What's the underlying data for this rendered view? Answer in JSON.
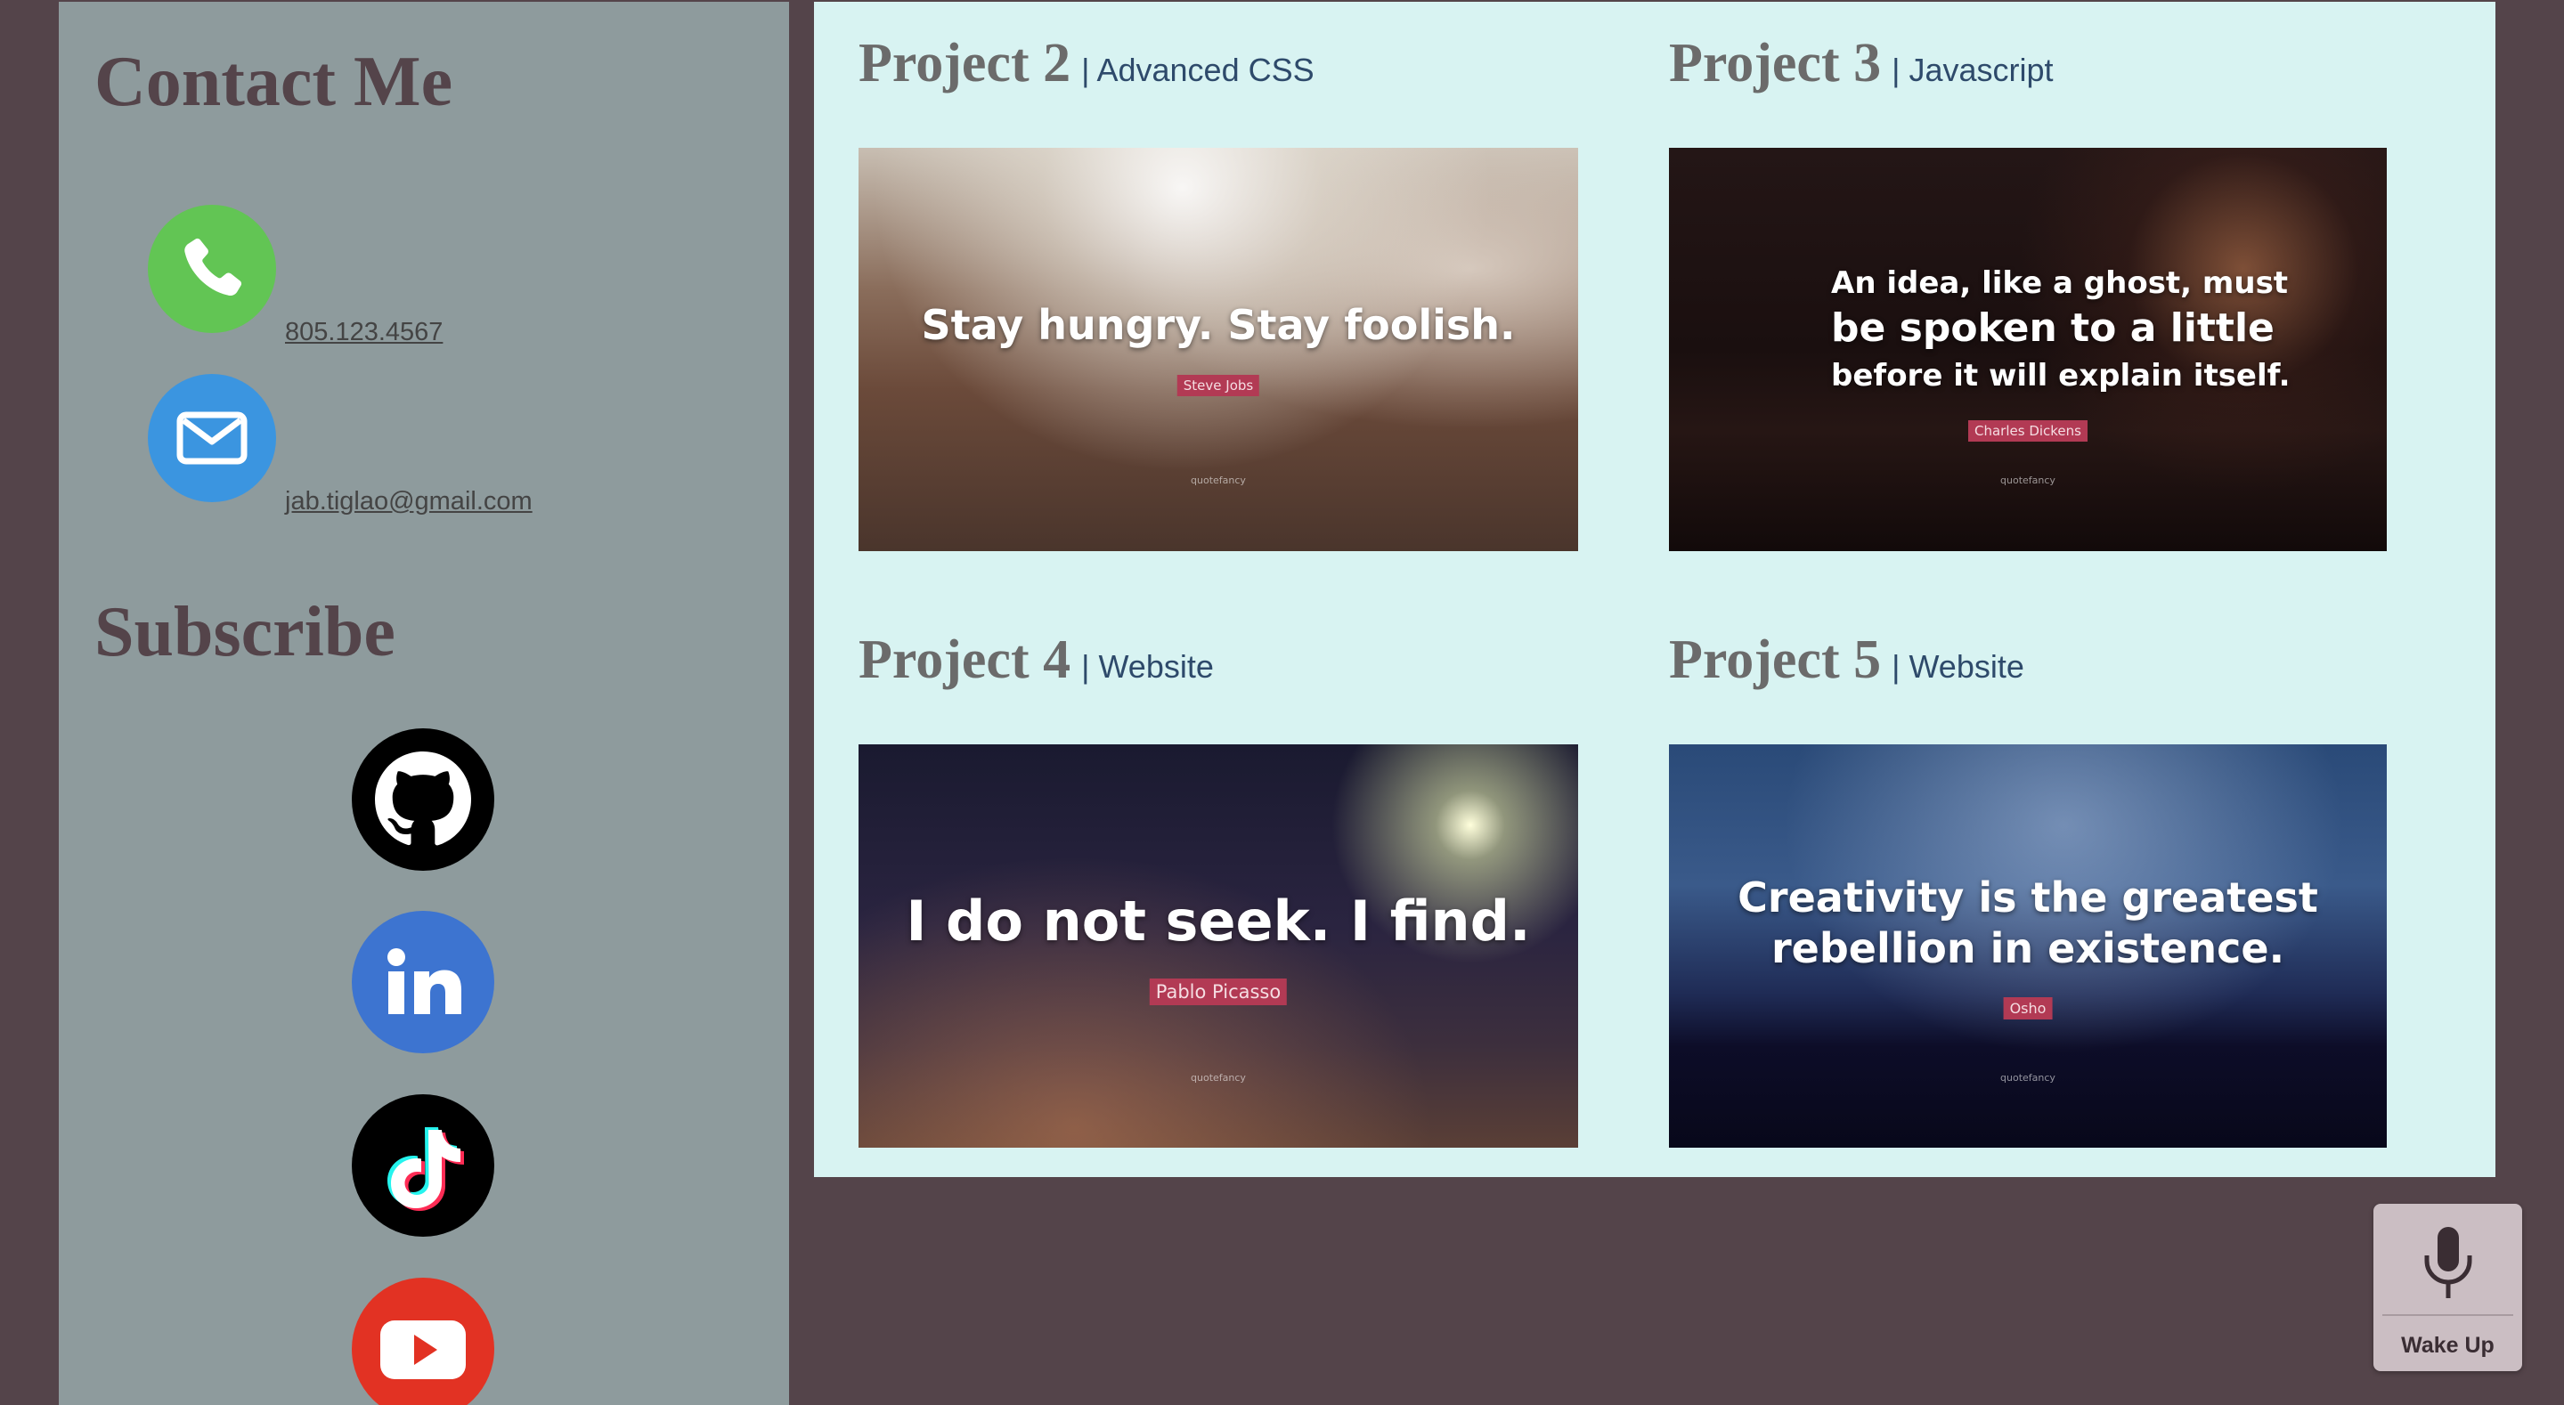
{
  "colors": {
    "page_bg": "#54444a",
    "sidebar_bg": "#8e9b9d",
    "main_bg": "#d8f3f2",
    "phone_green": "#62c554",
    "mail_blue": "#3b95e0",
    "linkedin_blue": "#3d74d0",
    "youtube_red": "#e23223"
  },
  "sidebar": {
    "contact_title": "Contact Me",
    "phone": {
      "icon": "phone-icon",
      "text": "805.123.4567"
    },
    "email": {
      "icon": "mail-icon",
      "text": "jab.tiglao@gmail.com"
    },
    "subscribe_title": "Subscribe",
    "socials": [
      {
        "icon": "github-icon"
      },
      {
        "icon": "linkedin-icon"
      },
      {
        "icon": "tiktok-icon"
      },
      {
        "icon": "youtube-icon"
      }
    ]
  },
  "projects": [
    {
      "name": "Project 2",
      "subtitle": "| Advanced CSS",
      "quote": "Stay hungry. Stay foolish.",
      "author": "Steve Jobs",
      "brand": "quotefancy"
    },
    {
      "name": "Project 3",
      "subtitle": "| Javascript",
      "quote_lines": [
        "An idea, like a ghost, must",
        "be spoken to a little",
        "before it will explain itself."
      ],
      "author": "Charles Dickens",
      "brand": "quotefancy"
    },
    {
      "name": "Project 4",
      "subtitle": "| Website",
      "quote": "I do not seek. I find.",
      "author": "Pablo Picasso",
      "brand": "quotefancy"
    },
    {
      "name": "Project 5",
      "subtitle": "| Website",
      "quote_lines": [
        "Creativity is the greatest",
        "rebellion in existence."
      ],
      "author": "Osho",
      "brand": "quotefancy"
    }
  ],
  "wake_button": {
    "icon": "microphone-icon",
    "label": "Wake Up"
  }
}
